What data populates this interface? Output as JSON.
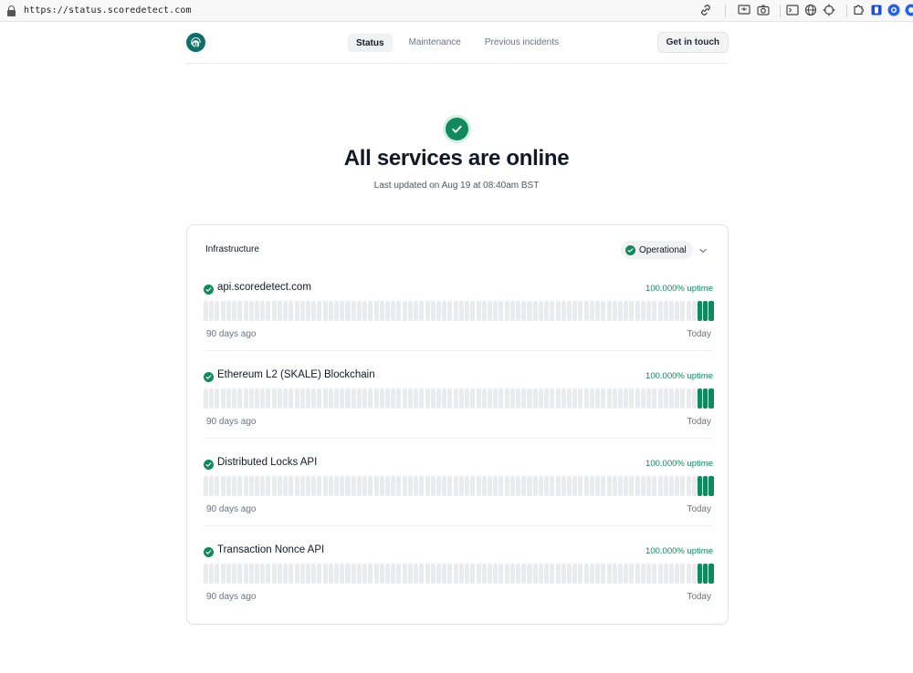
{
  "browser": {
    "url": "https://status.scoredetect.com",
    "icons": [
      "link-icon",
      "screen-icon",
      "camera-icon",
      "terminal-icon",
      "globe-icon",
      "crosshair-icon",
      "extension-icon",
      "bookmark-icon",
      "profile-icon"
    ]
  },
  "header": {
    "nav": [
      {
        "label": "Status",
        "active": true
      },
      {
        "label": "Maintenance",
        "active": false
      },
      {
        "label": "Previous incidents",
        "active": false
      }
    ],
    "cta_label": "Get in touch"
  },
  "hero": {
    "title": "All services are online",
    "subtitle": "Last updated on Aug 19 at 08:40am BST"
  },
  "group": {
    "title": "Infrastructure",
    "status": "Operational",
    "services": [
      {
        "name": "api.scoredetect.com",
        "uptime": "100.000% uptime",
        "left_label": "90 days ago",
        "right_label": "Today",
        "total_days": 90,
        "operational_days": 3
      },
      {
        "name": "Ethereum L2 (SKALE) Blockchain",
        "uptime": "100.000% uptime",
        "left_label": "90 days ago",
        "right_label": "Today",
        "total_days": 90,
        "operational_days": 3
      },
      {
        "name": "Distributed Locks API",
        "uptime": "100.000% uptime",
        "left_label": "90 days ago",
        "right_label": "Today",
        "total_days": 90,
        "operational_days": 3
      },
      {
        "name": "Transaction Nonce API",
        "uptime": "100.000% uptime",
        "left_label": "90 days ago",
        "right_label": "Today",
        "total_days": 90,
        "operational_days": 3
      }
    ]
  },
  "colors": {
    "accent": "#108a5c",
    "no_data": "#e9ebef",
    "logo": "#0f6e68"
  }
}
